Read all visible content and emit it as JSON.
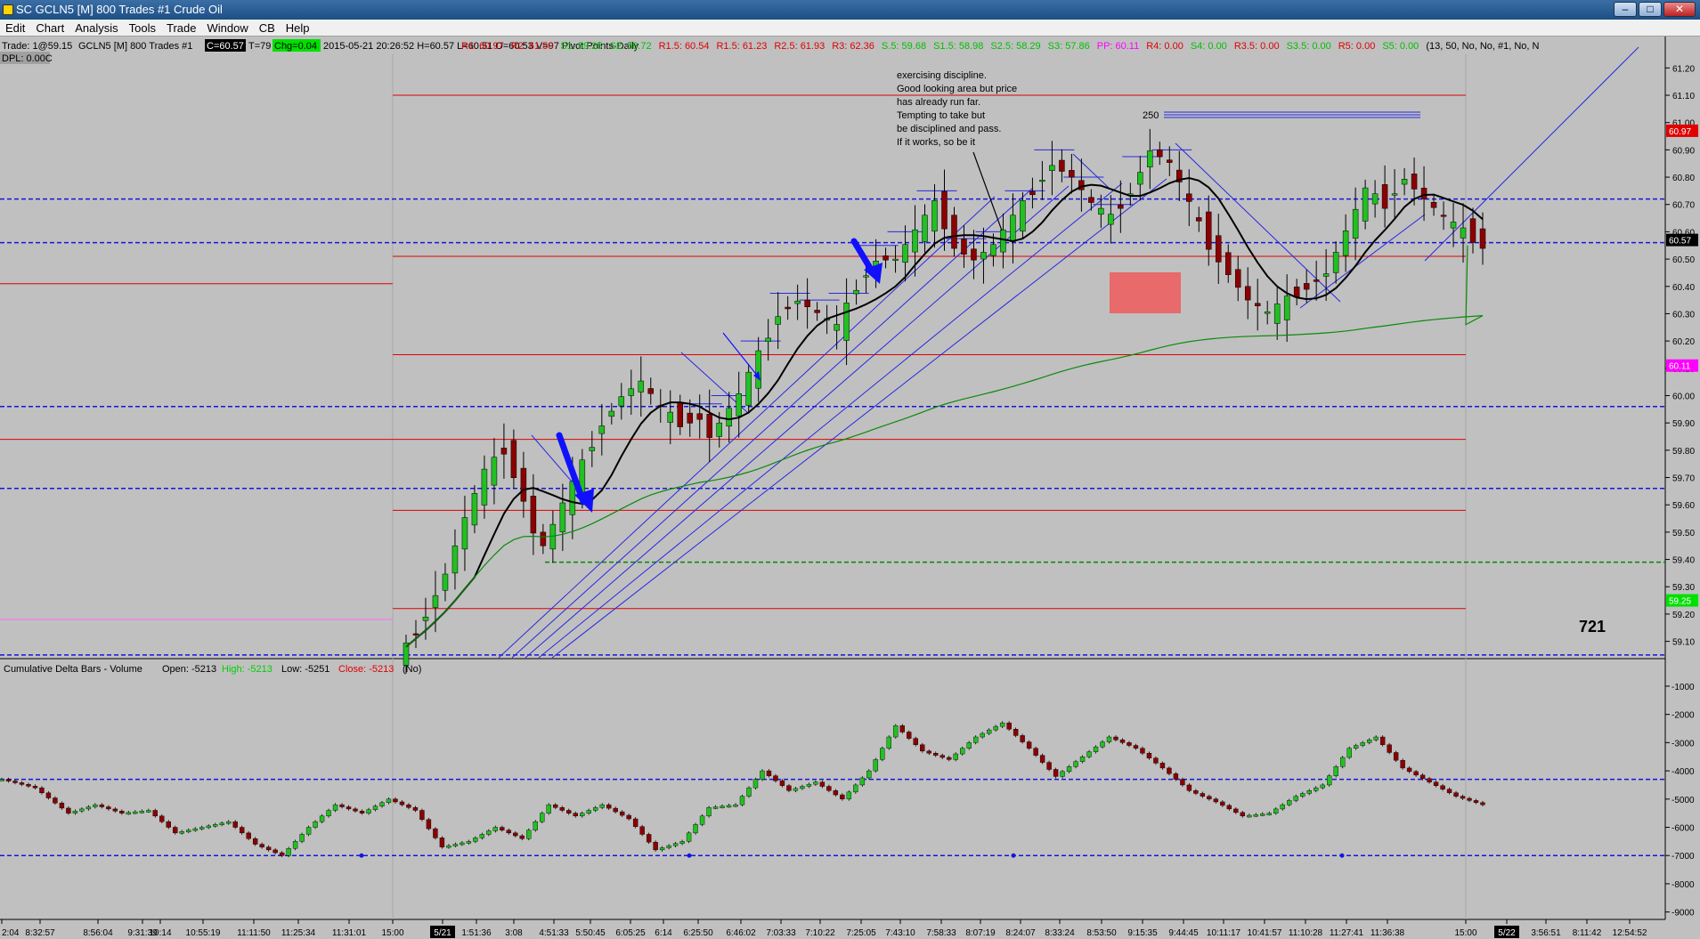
{
  "window": {
    "title": "SC GCLN5 [M]  800 Trades  #1  Crude Oil",
    "buttons": {
      "minimize": "–",
      "maximize": "□",
      "close": "✕"
    }
  },
  "menu": [
    "Edit",
    "Chart",
    "Analysis",
    "Tools",
    "Trade",
    "Window",
    "CB",
    "Help"
  ],
  "header": {
    "trade": "Trade: 1@59.15",
    "symbol": "GCLN5 [M]  800 Trades  #1",
    "last": "C=60.57",
    "trades": "T=79",
    "chg": "Chg=0.04",
    "ohlc": "2015-05-21  20:26:52 H=60.57 L=60.51 O=60.53 V=97 Pivot Points-Daily",
    "dpl": "DPL: 0.00C",
    "pivots": [
      {
        "text": "R1: 60.97",
        "color": "#e00000"
      },
      {
        "text": "R2: 61.50",
        "color": "#e00000"
      },
      {
        "text": "S1: 59.25",
        "color": "#00c000"
      },
      {
        "text": "S2: 58.72",
        "color": "#00c000"
      },
      {
        "text": "R1.5: 60.54",
        "color": "#e00000"
      },
      {
        "text": "R1.5: 61.23",
        "color": "#e00000"
      },
      {
        "text": "R2.5: 61.93",
        "color": "#e00000"
      },
      {
        "text": "R3: 62.36",
        "color": "#e00000"
      },
      {
        "text": "S.5: 59.68",
        "color": "#00c000"
      },
      {
        "text": "S1.5: 58.98",
        "color": "#00c000"
      },
      {
        "text": "S2.5: 58.29",
        "color": "#00c000"
      },
      {
        "text": "S3: 57.86",
        "color": "#00c000"
      },
      {
        "text": "PP: 60.11",
        "color": "#ff00ff"
      },
      {
        "text": "R4: 0.00",
        "color": "#e00000"
      },
      {
        "text": "S4: 0.00",
        "color": "#00c000"
      },
      {
        "text": "R3.5: 0.00",
        "color": "#e00000"
      },
      {
        "text": "S3.5: 0.00",
        "color": "#00c000"
      },
      {
        "text": "R5: 0.00",
        "color": "#e00000"
      },
      {
        "text": "S5: 0.00",
        "color": "#00c000"
      },
      {
        "text": "(13, 50, No, No, #1, No, N",
        "color": "#000000"
      }
    ]
  },
  "annotations": {
    "note": [
      "exercising discipline.",
      "Good looking area but price",
      "has already run far.",
      " Tempting to take but",
      "be disciplined and pass.",
      "If it works, so be it"
    ],
    "label_250": "250",
    "label_721": "721"
  },
  "chart_data": [
    {
      "type": "candlestick",
      "name_shown": "",
      "ylim": [
        59.04,
        61.25
      ],
      "y_ticks": [
        "61.20",
        "61.10",
        "61.00",
        "60.90",
        "60.80",
        "60.70",
        "60.60",
        "60.50",
        "60.40",
        "60.30",
        "60.20",
        "60.10",
        "60.00",
        "59.90",
        "59.80",
        "59.70",
        "59.60",
        "59.50",
        "59.40",
        "59.30",
        "59.20",
        "59.10"
      ],
      "price_tags": [
        {
          "text": "60.97",
          "value": 60.97,
          "bg": "#e00000",
          "fg": "#ffffff"
        },
        {
          "text": "60.57",
          "value": 60.57,
          "bg": "#000000",
          "fg": "#ffffff"
        },
        {
          "text": "60.11",
          "value": 60.11,
          "bg": "#ff00ff",
          "fg": "#ffffff"
        },
        {
          "text": "59.25",
          "value": 59.25,
          "bg": "#00e000",
          "fg": "#ffffff"
        }
      ],
      "pivot_levels": [
        {
          "name": "R2",
          "value": 61.1,
          "color": "#e00000"
        },
        {
          "name": "R1",
          "value": 60.51,
          "color": "#e00000"
        },
        {
          "name": "PP",
          "value": 60.15,
          "color": "#e00000"
        },
        {
          "name": "S.5",
          "value": 59.84,
          "color": "#e00000"
        },
        {
          "name": "S1",
          "value": 59.58,
          "color": "#e00000"
        },
        {
          "name": "S1.5",
          "value": 59.22,
          "color": "#e00000"
        }
      ],
      "blue_levels": [
        60.72,
        60.56,
        59.96,
        59.66,
        59.05
      ],
      "green_level": 59.39,
      "prev_day_levels": [
        {
          "value": 60.41,
          "color": "#e00000"
        },
        {
          "value": 59.84,
          "color": "#e00000"
        },
        {
          "value": 59.18,
          "color": "#ff66ff"
        }
      ],
      "close_path": [
        [
          0,
          59.08
        ],
        [
          2,
          59.2
        ],
        [
          4,
          59.35
        ],
        [
          6,
          59.55
        ],
        [
          8,
          59.72
        ],
        [
          10,
          59.8
        ],
        [
          12,
          59.62
        ],
        [
          13,
          59.5
        ],
        [
          14,
          59.45
        ],
        [
          16,
          59.6
        ],
        [
          18,
          59.75
        ],
        [
          20,
          59.9
        ],
        [
          22,
          60.0
        ],
        [
          24,
          60.05
        ],
        [
          26,
          59.95
        ],
        [
          28,
          59.9
        ],
        [
          30,
          59.92
        ],
        [
          31,
          59.85
        ],
        [
          32,
          59.9
        ],
        [
          34,
          60.0
        ],
        [
          36,
          60.15
        ],
        [
          38,
          60.3
        ],
        [
          40,
          60.35
        ],
        [
          42,
          60.3
        ],
        [
          44,
          60.25
        ],
        [
          46,
          60.4
        ],
        [
          48,
          60.5
        ],
        [
          50,
          60.5
        ],
        [
          52,
          60.6
        ],
        [
          54,
          60.7
        ],
        [
          56,
          60.55
        ],
        [
          58,
          60.5
        ],
        [
          60,
          60.55
        ],
        [
          62,
          60.65
        ],
        [
          64,
          60.75
        ],
        [
          66,
          60.85
        ],
        [
          68,
          60.8
        ],
        [
          70,
          60.7
        ],
        [
          72,
          60.65
        ],
        [
          74,
          60.75
        ],
        [
          76,
          60.9
        ],
        [
          78,
          60.85
        ],
        [
          80,
          60.7
        ],
        [
          82,
          60.55
        ],
        [
          84,
          60.45
        ],
        [
          86,
          60.35
        ],
        [
          88,
          60.3
        ],
        [
          90,
          60.35
        ],
        [
          92,
          60.4
        ],
        [
          94,
          60.45
        ],
        [
          96,
          60.6
        ],
        [
          98,
          60.75
        ],
        [
          100,
          60.7
        ],
        [
          102,
          60.8
        ],
        [
          104,
          60.72
        ],
        [
          106,
          60.65
        ],
        [
          108,
          60.6
        ],
        [
          110,
          60.55
        ]
      ],
      "n_bars": 111,
      "x_tick_labels": [
        "2:04",
        "8:32:57",
        "8:56:04",
        "9:31:39",
        "10:14",
        "10:55:19",
        "11:11:50",
        "11:25:34",
        "11:31:01",
        "15:00",
        "5/21",
        "1:51:36",
        "3:08",
        "4:51:33",
        "5:50:45",
        "6:05:25",
        "6:14",
        "6:25:50",
        "6:46:02",
        "7:03:33",
        "7:10:22",
        "7:25:05",
        "7:43:10",
        "7:58:33",
        "8:07:19",
        "8:24:07",
        "8:33:24",
        "8:53:50",
        "9:15:35",
        "9:44:45",
        "10:11:17",
        "10:41:57",
        "11:10:28",
        "11:27:41",
        "11:36:38",
        "15:00",
        "5/22",
        "3:56:51",
        "8:11:42",
        "12:54:52"
      ]
    },
    {
      "type": "bar",
      "name_shown": "Cumulative Delta Bars - Volume",
      "header": {
        "open": "Open: -5213",
        "high": "High: -5213",
        "low": "Low: -5251",
        "close": "Close: -5213",
        "extra": "(No)"
      },
      "ylim": [
        -9200,
        -750
      ],
      "y_ticks": [
        "-1000",
        "-2000",
        "-3000",
        "-4000",
        "-5000",
        "-6000",
        "-7000",
        "-8000",
        "-9000"
      ],
      "blue_levels": [
        -4300,
        -7000
      ],
      "path": [
        [
          0,
          -4300
        ],
        [
          5,
          -4600
        ],
        [
          10,
          -5500
        ],
        [
          14,
          -5200
        ],
        [
          18,
          -5500
        ],
        [
          22,
          -5400
        ],
        [
          26,
          -6200
        ],
        [
          30,
          -6000
        ],
        [
          34,
          -5800
        ],
        [
          38,
          -6600
        ],
        [
          42,
          -7000
        ],
        [
          46,
          -6000
        ],
        [
          50,
          -5200
        ],
        [
          54,
          -5500
        ],
        [
          58,
          -5000
        ],
        [
          62,
          -5400
        ],
        [
          66,
          -6700
        ],
        [
          70,
          -6500
        ],
        [
          74,
          -6000
        ],
        [
          78,
          -6400
        ],
        [
          82,
          -5200
        ],
        [
          86,
          -5600
        ],
        [
          90,
          -5200
        ],
        [
          94,
          -5700
        ],
        [
          98,
          -6800
        ],
        [
          102,
          -6500
        ],
        [
          106,
          -5300
        ],
        [
          110,
          -5200
        ],
        [
          114,
          -4000
        ],
        [
          118,
          -4700
        ],
        [
          122,
          -4400
        ],
        [
          126,
          -5000
        ],
        [
          130,
          -4000
        ],
        [
          134,
          -2400
        ],
        [
          138,
          -3300
        ],
        [
          142,
          -3600
        ],
        [
          146,
          -2800
        ],
        [
          150,
          -2300
        ],
        [
          154,
          -3200
        ],
        [
          158,
          -4200
        ],
        [
          162,
          -3500
        ],
        [
          166,
          -2800
        ],
        [
          170,
          -3200
        ],
        [
          174,
          -3900
        ],
        [
          178,
          -4700
        ],
        [
          182,
          -5100
        ],
        [
          186,
          -5600
        ],
        [
          190,
          -5500
        ],
        [
          194,
          -4900
        ],
        [
          198,
          -4500
        ],
        [
          202,
          -3200
        ],
        [
          206,
          -2800
        ],
        [
          210,
          -3900
        ],
        [
          214,
          -4400
        ],
        [
          218,
          -4900
        ],
        [
          222,
          -5200
        ]
      ]
    }
  ]
}
